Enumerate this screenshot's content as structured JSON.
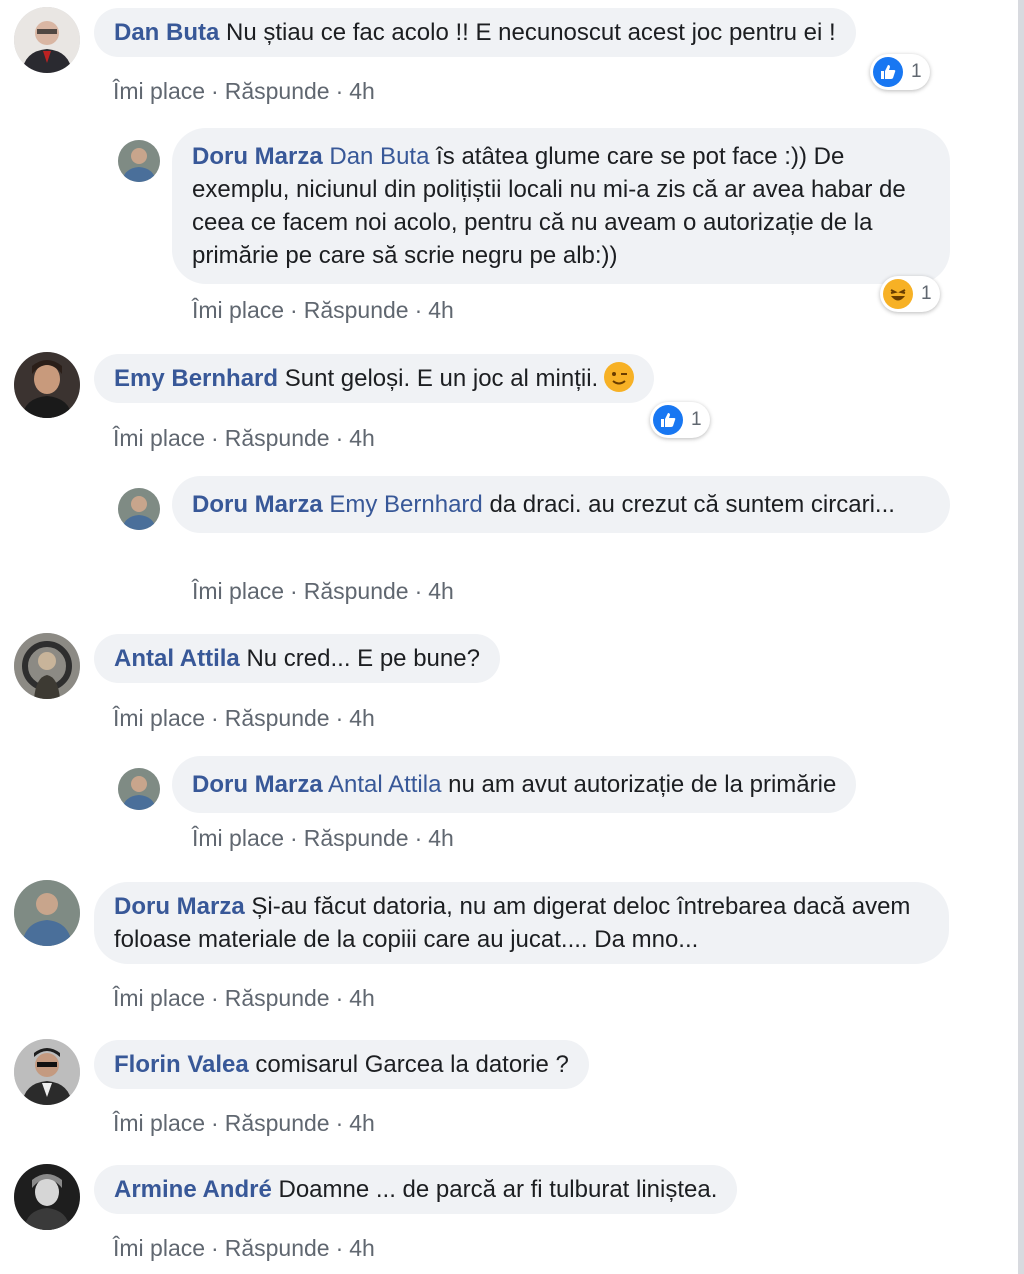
{
  "actions": {
    "like": "Îmi place",
    "reply": "Răspunde",
    "dot": "·"
  },
  "comments": [
    {
      "author": "Dan Buta",
      "text": "Nu știau ce fac acolo !! E necunoscut acest joc pentru ei !",
      "time": "4h",
      "reaction": {
        "icon": "like-icon",
        "count": "1"
      }
    },
    {
      "author": "Doru Marza",
      "mention": "Dan Buta",
      "text": "îs atâtea glume care se pot face :)) De exemplu, niciunul din polițiștii locali nu mi-a zis că ar avea habar de ceea ce facem noi acolo, pentru că nu aveam o autorizație de la primărie pe care să scrie negru pe alb:))",
      "time": "4h",
      "reaction": {
        "icon": "haha-icon",
        "count": "1"
      }
    },
    {
      "author": "Emy Bernhard",
      "text": "Sunt geloși. E un joc al minții.",
      "emoji": "wink-emoji-icon",
      "time": "4h",
      "reaction": {
        "icon": "like-icon",
        "count": "1"
      }
    },
    {
      "author": "Doru Marza",
      "mention": "Emy Bernhard",
      "text": "da draci. au crezut că suntem circari...",
      "time": "4h"
    },
    {
      "author": "Antal Attila",
      "text": "Nu cred... E pe bune?",
      "time": "4h"
    },
    {
      "author": "Doru Marza",
      "mention": "Antal Attila",
      "text": "nu am avut autorizație de la primărie",
      "time": "4h"
    },
    {
      "author": "Doru Marza",
      "text": "Și-au făcut datoria, nu am digerat deloc întrebarea dacă avem foloase materiale de la copiii care au jucat.... Da mno...",
      "time": "4h"
    },
    {
      "author": "Florin Valea",
      "text": "comisarul Garcea la datorie ?",
      "time": "4h"
    },
    {
      "author": "Armine André",
      "text": "Doamne ... de parcă ar fi tulburat liniștea.",
      "time": "4h"
    }
  ],
  "colors": {
    "author": "#385898",
    "bubble": "#f0f2f5",
    "meta": "#606770",
    "like": "#1877f2",
    "haha": "#f7b125"
  }
}
